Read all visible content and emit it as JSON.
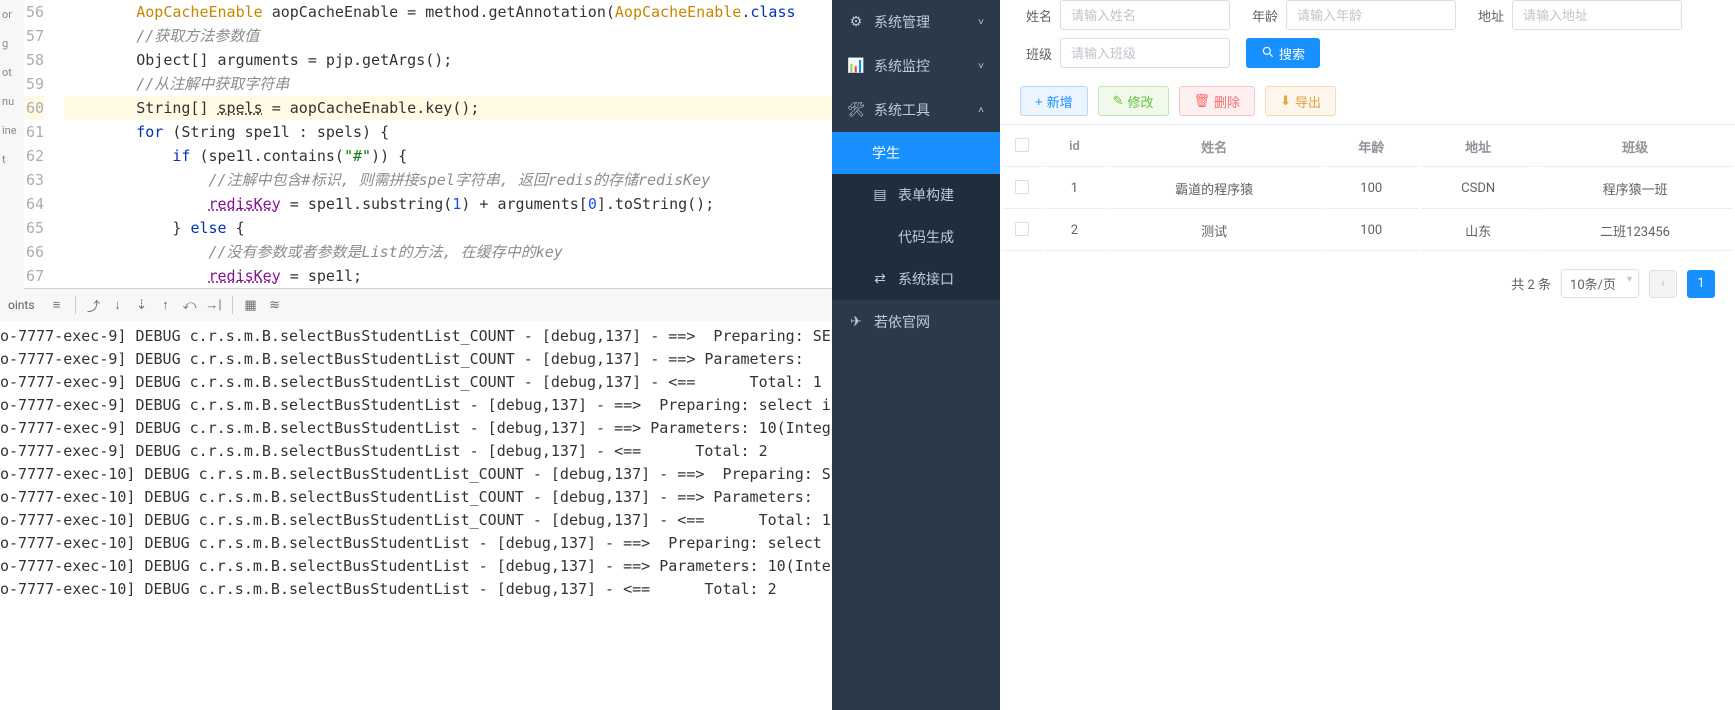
{
  "ide": {
    "gutter": [
      "56",
      "57",
      "58",
      "59",
      "60",
      "61",
      "62",
      "63",
      "64",
      "65",
      "66",
      "67"
    ],
    "left_sliver": [
      "or",
      "g",
      "ot",
      "nu",
      "ine",
      "t"
    ],
    "code_lines": [
      {
        "type": "code",
        "indent": 2,
        "tokens": [
          [
            "cls",
            "AopCacheEnable"
          ],
          [
            "plain",
            " aopCacheEnable = method.getAnnotation("
          ],
          [
            "cls",
            "AopCacheEnable"
          ],
          [
            "plain",
            "."
          ],
          [
            "kw",
            "class"
          ]
        ]
      },
      {
        "type": "comment",
        "indent": 2,
        "text": "//获取方法参数值"
      },
      {
        "type": "code",
        "indent": 2,
        "tokens": [
          [
            "plain",
            "Object[] arguments = pjp.getArgs();"
          ]
        ]
      },
      {
        "type": "comment",
        "indent": 2,
        "text": "//从注解中获取字符串"
      },
      {
        "type": "code",
        "indent": 2,
        "hl": true,
        "tokens": [
          [
            "plain",
            "String[] "
          ],
          [
            "und",
            "spels"
          ],
          [
            "plain",
            " = aopCacheEnable.key();"
          ]
        ]
      },
      {
        "type": "code",
        "indent": 2,
        "tokens": [
          [
            "kw",
            "for"
          ],
          [
            "plain",
            " (String spe1l : spels) {"
          ]
        ]
      },
      {
        "type": "code",
        "indent": 3,
        "tokens": [
          [
            "kw",
            "if"
          ],
          [
            "plain",
            " (spe1l.contains("
          ],
          [
            "str",
            "\"#\""
          ],
          [
            "plain",
            ")) {"
          ]
        ]
      },
      {
        "type": "comment",
        "indent": 4,
        "text": "//注解中包含#标识, 则需拼接spel字符串, 返回redis的存储redisKey"
      },
      {
        "type": "code",
        "indent": 4,
        "tokens": [
          [
            "fld und",
            "redisKey"
          ],
          [
            "plain",
            " = spe1l.substring("
          ],
          [
            "num",
            "1"
          ],
          [
            "plain",
            ") + arguments["
          ],
          [
            "num",
            "0"
          ],
          [
            "plain",
            "].toString();"
          ]
        ]
      },
      {
        "type": "code",
        "indent": 3,
        "tokens": [
          [
            "plain",
            "} "
          ],
          [
            "kw",
            "else"
          ],
          [
            "plain",
            " {"
          ]
        ]
      },
      {
        "type": "comment",
        "indent": 4,
        "text": "//没有参数或者参数是List的方法, 在缓存中的key"
      },
      {
        "type": "code",
        "indent": 4,
        "tokens": [
          [
            "fld und",
            "redisKey"
          ],
          [
            "plain",
            " = spe1l;"
          ]
        ]
      }
    ],
    "toolbar_label": "oints",
    "console_lines": [
      "o-7777-exec-9] DEBUG c.r.s.m.B.selectBusStudentList_COUNT - [debug,137] - ==>  Preparing: SE",
      "o-7777-exec-9] DEBUG c.r.s.m.B.selectBusStudentList_COUNT - [debug,137] - ==> Parameters: ",
      "o-7777-exec-9] DEBUG c.r.s.m.B.selectBusStudentList_COUNT - [debug,137] - <==      Total: 1",
      "o-7777-exec-9] DEBUG c.r.s.m.B.selectBusStudentList - [debug,137] - ==>  Preparing: select i",
      "o-7777-exec-9] DEBUG c.r.s.m.B.selectBusStudentList - [debug,137] - ==> Parameters: 10(Integ",
      "o-7777-exec-9] DEBUG c.r.s.m.B.selectBusStudentList - [debug,137] - <==      Total: 2",
      "o-7777-exec-10] DEBUG c.r.s.m.B.selectBusStudentList_COUNT - [debug,137] - ==>  Preparing: S",
      "o-7777-exec-10] DEBUG c.r.s.m.B.selectBusStudentList_COUNT - [debug,137] - ==> Parameters: ",
      "o-7777-exec-10] DEBUG c.r.s.m.B.selectBusStudentList_COUNT - [debug,137] - <==      Total: 1",
      "o-7777-exec-10] DEBUG c.r.s.m.B.selectBusStudentList - [debug,137] - ==>  Preparing: select ",
      "o-7777-exec-10] DEBUG c.r.s.m.B.selectBusStudentList - [debug,137] - ==> Parameters: 10(Inte",
      "o-7777-exec-10] DEBUG c.r.s.m.B.selectBusStudentList - [debug,137] - <==      Total: 2"
    ]
  },
  "sidebar": {
    "items": [
      {
        "icon": "gear",
        "label": "系统管理",
        "chev": "down"
      },
      {
        "icon": "monitor",
        "label": "系统监控",
        "chev": "down"
      },
      {
        "icon": "tool",
        "label": "系统工具",
        "chev": "up"
      },
      {
        "sub": true,
        "active": true,
        "label": "学生"
      },
      {
        "sub": true,
        "icon": "form",
        "label": "表单构建"
      },
      {
        "sub": true,
        "icon": "code",
        "label": "代码生成"
      },
      {
        "sub": true,
        "icon": "api",
        "label": "系统接口"
      },
      {
        "icon": "link",
        "label": "若依官网"
      }
    ]
  },
  "panel": {
    "filters": {
      "name_label": "姓名",
      "name_placeholder": "请输入姓名",
      "age_label": "年龄",
      "age_placeholder": "请输入年龄",
      "addr_label": "地址",
      "addr_placeholder": "请输入地址",
      "class_label": "班级",
      "class_placeholder": "请输入班级",
      "search_label": "搜索"
    },
    "actions": {
      "add": "新增",
      "edit": "修改",
      "delete": "删除",
      "export": "导出"
    },
    "table": {
      "headers": [
        "id",
        "姓名",
        "年龄",
        "地址",
        "班级"
      ],
      "rows": [
        {
          "id": "1",
          "name": "霸道的程序猿",
          "age": "100",
          "addr": "CSDN",
          "cls": "程序猿一班"
        },
        {
          "id": "2",
          "name": "测试",
          "age": "100",
          "addr": "山东",
          "cls": "二班123456"
        }
      ]
    },
    "pagination": {
      "total_text": "共 2 条",
      "page_size": "10条/页",
      "current": "1"
    }
  }
}
